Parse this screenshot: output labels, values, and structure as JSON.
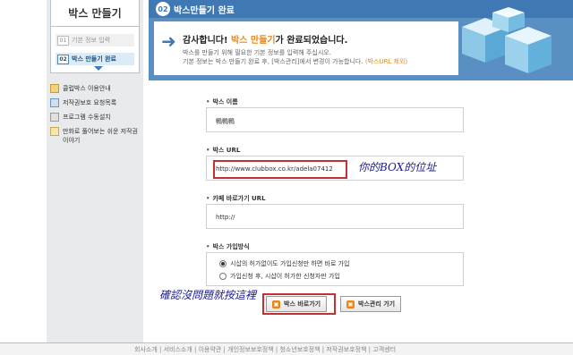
{
  "sidebar": {
    "title": "박스 만들기",
    "steps": [
      {
        "num": "01",
        "label": "기본 정보 입력"
      },
      {
        "num": "02",
        "label": "박스 만들기 완료"
      }
    ],
    "links": [
      {
        "label": "클럽박스 이용안내",
        "icon": "book-icon"
      },
      {
        "label": "저작권보호 요청목록",
        "icon": "document-icon"
      },
      {
        "label": "프로그램 수동설치",
        "icon": "gear-icon"
      },
      {
        "label": "만화로 풀어보는 쉬운 저작권 이야기",
        "icon": "comic-icon"
      }
    ]
  },
  "header": {
    "step_num": "02",
    "title": "박스만들기 완료",
    "thanks_pre": "감사합니다! ",
    "thanks_hl": "박스 만들기",
    "thanks_post": "가 완료되었습니다.",
    "desc_line1": "박스를 만들기 위해 필요한 기본 정보를 입력해 주십시오.",
    "desc_line2_pre": "기본 정보는 박스 만들기 완료 후, [박스관리]에서 변경이 가능합니다. ",
    "desc_line2_hl": "(박스URL 제외)"
  },
  "form": {
    "name_label": "박스 이름",
    "name_value": "鴨鴨鴨",
    "url_label": "박스 URL",
    "url_value": "http://www.clubbox.co.kr/adela07412",
    "cafe_label": "카페 바로가기 URL",
    "cafe_value": "http://",
    "join_label": "박스 가입방식",
    "join_option1": "시삽의 허가없이도 가입신청만 하면 바로 가입",
    "join_option2": "가입신청 후, 시삽이 허가한 신청자만 가입"
  },
  "buttons": {
    "go_box": "박스 바로가기",
    "manage_box": "박스관리 가기"
  },
  "annotations": {
    "url_note": "你的BOX的位址",
    "button_note": "確認沒問題就按這裡"
  },
  "footer": {
    "text": "회사소개 | 서비스소개 | 이용약관 | 개인정보보호정책 | 청소년보호정책 | 저작권보호정책 | 고객센터"
  },
  "colors": {
    "header_bg": "#5a8fc4",
    "accent": "#e7871a",
    "annotation_red": "#c33030"
  }
}
